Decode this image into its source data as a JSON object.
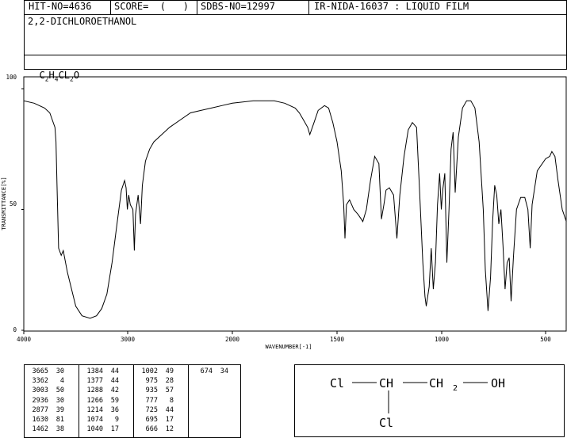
{
  "header": {
    "hit_no": "HIT-NO=4636",
    "score": "SCORE=  (   )",
    "sdbs_no": "SDBS-NO=12997",
    "ir_info": "IR-NIDA-16037 : LIQUID FILM",
    "compound_name": "2,2-DICHLOROETHANOL",
    "formula_parts": [
      "C",
      "2",
      "H",
      "4",
      "CL",
      "2",
      "O"
    ]
  },
  "chart_data": {
    "type": "line",
    "xlabel": "WAVENUMBER[-1]",
    "ylabel": "TRANSMITTANCE[%]",
    "xlim": [
      4000,
      400
    ],
    "ylim": [
      0,
      100
    ],
    "x_ticks": [
      "4000",
      "3000",
      "2000",
      "1500",
      "1000",
      "500"
    ],
    "x_tick_values": [
      4000,
      3000,
      2000,
      1500,
      1000,
      500
    ],
    "y_ticks": [
      "100",
      "50",
      "0"
    ],
    "y_tick_values": [
      100,
      50,
      0
    ],
    "line_color": "#000000",
    "series": [
      {
        "points": [
          [
            4000,
            95
          ],
          [
            3900,
            94
          ],
          [
            3800,
            92
          ],
          [
            3750,
            90
          ],
          [
            3700,
            84
          ],
          [
            3690,
            78
          ],
          [
            3680,
            60
          ],
          [
            3665,
            34
          ],
          [
            3640,
            31
          ],
          [
            3620,
            33
          ],
          [
            3580,
            24
          ],
          [
            3500,
            10
          ],
          [
            3440,
            6
          ],
          [
            3362,
            5
          ],
          [
            3300,
            6
          ],
          [
            3250,
            9
          ],
          [
            3200,
            15
          ],
          [
            3150,
            28
          ],
          [
            3100,
            45
          ],
          [
            3060,
            58
          ],
          [
            3030,
            62
          ],
          [
            3015,
            59
          ],
          [
            3003,
            50
          ],
          [
            2990,
            56
          ],
          [
            2975,
            52
          ],
          [
            2950,
            50
          ],
          [
            2936,
            33
          ],
          [
            2925,
            48
          ],
          [
            2900,
            56
          ],
          [
            2877,
            44
          ],
          [
            2860,
            60
          ],
          [
            2830,
            70
          ],
          [
            2790,
            75
          ],
          [
            2750,
            78
          ],
          [
            2700,
            80
          ],
          [
            2600,
            84
          ],
          [
            2500,
            87
          ],
          [
            2400,
            90
          ],
          [
            2300,
            91
          ],
          [
            2200,
            92
          ],
          [
            2100,
            93
          ],
          [
            2000,
            94
          ],
          [
            1900,
            95
          ],
          [
            1800,
            95
          ],
          [
            1750,
            94
          ],
          [
            1700,
            92
          ],
          [
            1680,
            90
          ],
          [
            1660,
            87
          ],
          [
            1640,
            84
          ],
          [
            1630,
            81
          ],
          [
            1610,
            86
          ],
          [
            1590,
            91
          ],
          [
            1560,
            93
          ],
          [
            1540,
            92
          ],
          [
            1520,
            86
          ],
          [
            1500,
            78
          ],
          [
            1480,
            66
          ],
          [
            1468,
            52
          ],
          [
            1462,
            38
          ],
          [
            1455,
            52
          ],
          [
            1440,
            54
          ],
          [
            1420,
            50
          ],
          [
            1400,
            48
          ],
          [
            1384,
            46
          ],
          [
            1377,
            45
          ],
          [
            1360,
            50
          ],
          [
            1340,
            62
          ],
          [
            1320,
            72
          ],
          [
            1300,
            69
          ],
          [
            1288,
            46
          ],
          [
            1276,
            52
          ],
          [
            1266,
            58
          ],
          [
            1250,
            59
          ],
          [
            1230,
            56
          ],
          [
            1214,
            38
          ],
          [
            1200,
            56
          ],
          [
            1180,
            72
          ],
          [
            1160,
            83
          ],
          [
            1140,
            86
          ],
          [
            1120,
            84
          ],
          [
            1108,
            62
          ],
          [
            1090,
            28
          ],
          [
            1080,
            14
          ],
          [
            1074,
            10
          ],
          [
            1060,
            18
          ],
          [
            1050,
            34
          ],
          [
            1040,
            17
          ],
          [
            1030,
            28
          ],
          [
            1020,
            52
          ],
          [
            1010,
            65
          ],
          [
            1002,
            50
          ],
          [
            995,
            58
          ],
          [
            985,
            65
          ],
          [
            975,
            28
          ],
          [
            965,
            50
          ],
          [
            955,
            75
          ],
          [
            945,
            82
          ],
          [
            935,
            57
          ],
          [
            920,
            80
          ],
          [
            900,
            92
          ],
          [
            880,
            95
          ],
          [
            860,
            95
          ],
          [
            840,
            92
          ],
          [
            820,
            78
          ],
          [
            800,
            50
          ],
          [
            790,
            25
          ],
          [
            777,
            8
          ],
          [
            765,
            22
          ],
          [
            755,
            45
          ],
          [
            745,
            60
          ],
          [
            735,
            56
          ],
          [
            725,
            44
          ],
          [
            715,
            50
          ],
          [
            705,
            35
          ],
          [
            695,
            17
          ],
          [
            685,
            28
          ],
          [
            675,
            30
          ],
          [
            666,
            12
          ],
          [
            655,
            30
          ],
          [
            640,
            50
          ],
          [
            620,
            55
          ],
          [
            600,
            55
          ],
          [
            585,
            50
          ],
          [
            574,
            34
          ],
          [
            565,
            52
          ],
          [
            540,
            66
          ],
          [
            500,
            71
          ],
          [
            480,
            72
          ],
          [
            470,
            74
          ],
          [
            455,
            72
          ],
          [
            440,
            62
          ],
          [
            420,
            50
          ],
          [
            400,
            45
          ]
        ]
      }
    ]
  },
  "peak_table": {
    "columns": [
      [
        [
          "3665",
          "30"
        ],
        [
          "3362",
          "4"
        ],
        [
          "3003",
          "50"
        ],
        [
          "2936",
          "30"
        ],
        [
          "2877",
          "39"
        ],
        [
          "1630",
          "81"
        ],
        [
          "1462",
          "38"
        ]
      ],
      [
        [
          "1384",
          "44"
        ],
        [
          "1377",
          "44"
        ],
        [
          "1288",
          "42"
        ],
        [
          "1266",
          "59"
        ],
        [
          "1214",
          "36"
        ],
        [
          "1074",
          "9"
        ],
        [
          "1040",
          "17"
        ]
      ],
      [
        [
          "1002",
          "49"
        ],
        [
          "975",
          "28"
        ],
        [
          "935",
          "57"
        ],
        [
          "777",
          "8"
        ],
        [
          "725",
          "44"
        ],
        [
          "695",
          "17"
        ],
        [
          "666",
          "12"
        ]
      ],
      [
        [
          "674",
          "34"
        ]
      ]
    ]
  },
  "structure": {
    "atom_cl1": "Cl",
    "atom_ch": "CH",
    "atom_ch2": "CH",
    "ch2_sub": "2",
    "atom_oh": "OH",
    "atom_cl2": "Cl"
  }
}
